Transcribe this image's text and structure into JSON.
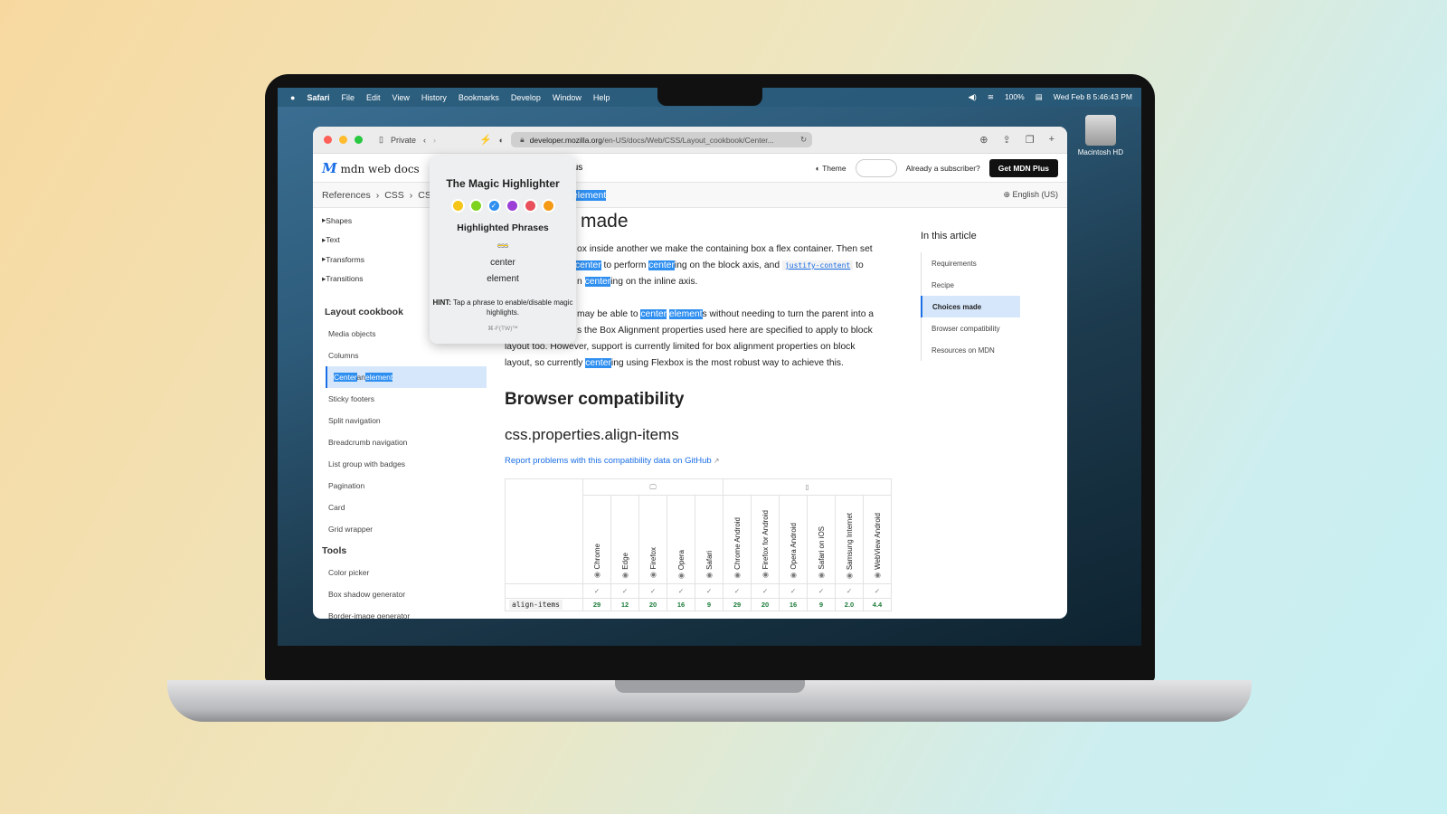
{
  "menubar": {
    "app": "Safari",
    "items": [
      "File",
      "Edit",
      "View",
      "History",
      "Bookmarks",
      "Develop",
      "Window",
      "Help"
    ],
    "battery": "100%",
    "datetime": "Wed Feb 8  5:46:43 PM"
  },
  "desktop": {
    "drive_label": "Macintosh HD"
  },
  "browser": {
    "private_label": "Private",
    "url_domain": "developer.mozilla.org",
    "url_path": "/en-US/docs/Web/CSS/Layout_cookbook/Center..."
  },
  "mdn": {
    "logo": "mdn web docs",
    "nav_partial": "us",
    "theme": "Theme",
    "subscriber": "Already a subscriber?",
    "get_plus": "Get MDN Plus",
    "language": "English (US)"
  },
  "breadcrumb": [
    "References",
    "CSS",
    "CS"
  ],
  "breadcrumb_highlight": "element",
  "sidebar": {
    "tree": [
      "Shapes",
      "Text",
      "Transforms",
      "Transitions"
    ],
    "section": "Layout cookbook",
    "items": [
      "Media objects",
      "Columns",
      "Center an element",
      "Sticky footers",
      "Split navigation",
      "Breadcrumb navigation",
      "List group with badges",
      "Pagination",
      "Card",
      "Grid wrapper"
    ],
    "selected": {
      "a": "Center",
      "b": " an ",
      "c": "element"
    },
    "tools_heading": "Tools",
    "tools": [
      "Color picker",
      "Box shadow generator",
      "Border-image generator"
    ]
  },
  "article": {
    "heading": "made",
    "p1": {
      "a": "ox inside another we make the containing box a flex container. Then set",
      "b1": "",
      "h1": "center",
      "b2": " to perform ",
      "h2": "center",
      "b3": "ing on the block axis, and ",
      "code": "justify-content",
      "b4": " to",
      "c1": "n ",
      "h3": "center",
      "c2": "ing on the inline axis."
    },
    "p2": {
      "a": "may be able to ",
      "h1": "center",
      "h2": "element",
      "b": "s without needing to turn the parent into a",
      "c": "s the Box Alignment properties used here are specified to apply to block",
      "d": "layout too. However, support is currently limited for box alignment properties on block",
      "e": "layout, so currently ",
      "h3": "center",
      "f": "ing using Flexbox is the most robust way to achieve this."
    },
    "compat_heading": "Browser compatibility",
    "compat_sub": "css.properties.align-items",
    "report_link": "Report problems with this compatibility data on GitHub"
  },
  "compat_table": {
    "browsers": [
      "Chrome",
      "Edge",
      "Firefox",
      "Opera",
      "Safari",
      "Chrome Android",
      "Firefox for Android",
      "Opera Android",
      "Safari on iOS",
      "Samsung Internet",
      "WebView Android"
    ],
    "feature": "align-items",
    "versions": [
      "29",
      "12",
      "20",
      "16",
      "9",
      "29",
      "20",
      "16",
      "9",
      "2.0",
      "4.4"
    ],
    "check": "✓"
  },
  "toc": {
    "title": "In this article",
    "items": [
      "Requirements",
      "Recipe",
      "Choices made",
      "Browser compatibility",
      "Resources on MDN"
    ],
    "active": "Choices made"
  },
  "popup": {
    "title": "The Magic Highlighter",
    "colors": [
      "#f5c518",
      "#7ed321",
      "#2f8ff0",
      "#9b3fd6",
      "#e8505b",
      "#f59a16"
    ],
    "selected_color": "#2f8ff0",
    "phrases_heading": "Highlighted Phrases",
    "phrases": [
      "css",
      "center",
      "element"
    ],
    "hint_label": "HINT:",
    "hint": " Tap a phrase to enable/disable magic highlights.",
    "shortcut": "⌘-F(TW)™"
  }
}
